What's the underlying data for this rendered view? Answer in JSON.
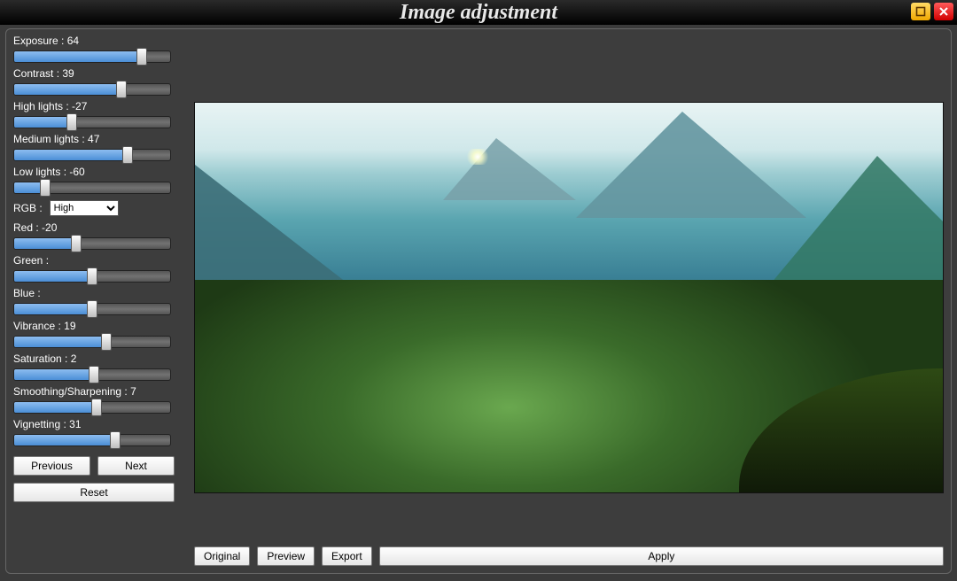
{
  "window": {
    "title": "Image adjustment"
  },
  "sliders": {
    "exposure": {
      "label": "Exposure",
      "value": 64,
      "min": -100,
      "max": 100,
      "pct": 82,
      "show_value": true
    },
    "contrast": {
      "label": "Contrast",
      "value": 39,
      "min": -100,
      "max": 100,
      "pct": 69,
      "show_value": true
    },
    "highlights": {
      "label": "High lights",
      "value": -27,
      "min": -100,
      "max": 100,
      "pct": 37,
      "show_value": true
    },
    "midlights": {
      "label": "Medium lights",
      "value": 47,
      "min": -100,
      "max": 100,
      "pct": 73,
      "show_value": true
    },
    "lowlights": {
      "label": "Low lights",
      "value": -60,
      "min": -100,
      "max": 100,
      "pct": 20,
      "show_value": true
    },
    "red": {
      "label": "Red",
      "value": -20,
      "min": -100,
      "max": 100,
      "pct": 40,
      "show_value": true
    },
    "green": {
      "label": "Green",
      "value": "",
      "min": -100,
      "max": 100,
      "pct": 50,
      "show_value": false
    },
    "blue": {
      "label": "Blue",
      "value": "",
      "min": -100,
      "max": 100,
      "pct": 50,
      "show_value": false
    },
    "vibrance": {
      "label": "Vibrance",
      "value": 19,
      "min": -100,
      "max": 100,
      "pct": 59,
      "show_value": true
    },
    "saturation": {
      "label": "Saturation",
      "value": 2,
      "min": -100,
      "max": 100,
      "pct": 51,
      "show_value": true
    },
    "sharpening": {
      "label": "Smoothing/Sharpening",
      "value": 7,
      "min": -100,
      "max": 100,
      "pct": 53,
      "show_value": true
    },
    "vignetting": {
      "label": "Vignetting",
      "value": 31,
      "min": -100,
      "max": 100,
      "pct": 65,
      "show_value": true
    }
  },
  "rgb": {
    "label": "RGB :",
    "selected": "High"
  },
  "buttons": {
    "previous": "Previous",
    "next": "Next",
    "reset": "Reset",
    "original": "Original",
    "preview": "Preview",
    "export": "Export",
    "apply": "Apply"
  }
}
